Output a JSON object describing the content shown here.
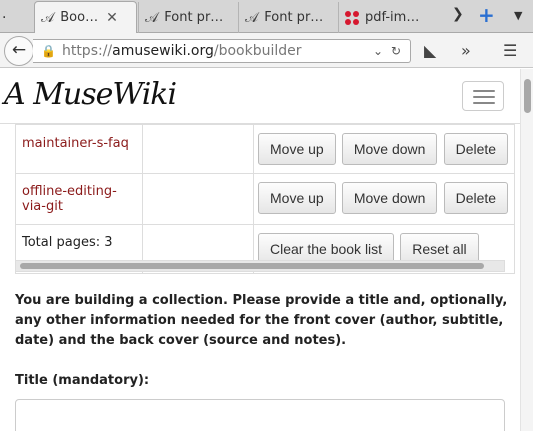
{
  "browser": {
    "tabs": [
      {
        "label": "Boo…",
        "active": true
      },
      {
        "label": "Font pr…"
      },
      {
        "label": "Font pr…"
      },
      {
        "label": "pdf-im…"
      }
    ],
    "url": {
      "scheme": "https://",
      "host": "amusewiki.org",
      "path": "/bookbuilder"
    }
  },
  "site": {
    "logo": "A MuseWiki"
  },
  "table": {
    "rows": [
      {
        "title": "maintainer-s-faq",
        "up": "Move up",
        "down": "Move down",
        "delete": "Delete"
      },
      {
        "title": "offline-editing-via-git",
        "up": "Move up",
        "down": "Move down",
        "delete": "Delete"
      }
    ],
    "total_label": "Total pages: 3",
    "clear_label": "Clear the book list",
    "reset_label": "Reset all"
  },
  "form": {
    "intro": "You are building a collection. Please provide a title and, optionally, any other information needed for the front cover (author, subtitle, date) and the back cover (source and notes).",
    "title_label": "Title (mandatory):",
    "title_value": ""
  },
  "colors": {
    "link": "#8b1a1a",
    "tab_plus": "#2a6fd1",
    "pdf_icon": "#d6182f"
  }
}
